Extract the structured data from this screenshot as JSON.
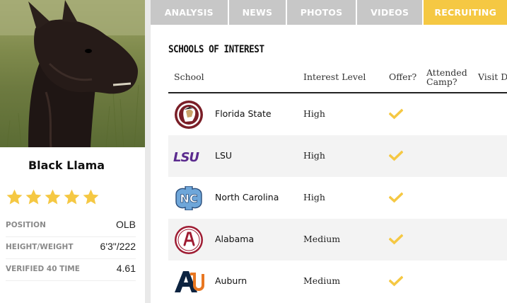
{
  "profile": {
    "name": "Black Llama",
    "stars": 5,
    "star_color": "#f5c843",
    "stats": [
      {
        "label": "POSITION",
        "value": "OLB"
      },
      {
        "label": "HEIGHT/WEIGHT",
        "value": "6'3\"/222"
      },
      {
        "label": "VERIFIED 40 TIME",
        "value": "4.61"
      }
    ]
  },
  "tabs": [
    {
      "label": "ANALYSIS",
      "active": false
    },
    {
      "label": "NEWS",
      "active": false
    },
    {
      "label": "PHOTOS",
      "active": false
    },
    {
      "label": "VIDEOS",
      "active": false
    },
    {
      "label": "RECRUITING",
      "active": true
    }
  ],
  "accent_color": "#f5c843",
  "recruiting": {
    "title": "SCHOOLS OF INTEREST",
    "columns": {
      "school": "School",
      "interest": "Interest Level",
      "offer": "Offer?",
      "attended_camp": "Attended Camp?",
      "visit": "Visit Da"
    },
    "schools": [
      {
        "name": "Florida State",
        "interest": "High",
        "offer": true,
        "logo": "florida-state-logo"
      },
      {
        "name": "LSU",
        "interest": "High",
        "offer": true,
        "logo": "lsu-logo"
      },
      {
        "name": "North Carolina",
        "interest": "High",
        "offer": true,
        "logo": "north-carolina-logo"
      },
      {
        "name": "Alabama",
        "interest": "Medium",
        "offer": true,
        "logo": "alabama-logo"
      },
      {
        "name": "Auburn",
        "interest": "Medium",
        "offer": true,
        "logo": "auburn-logo"
      }
    ]
  }
}
